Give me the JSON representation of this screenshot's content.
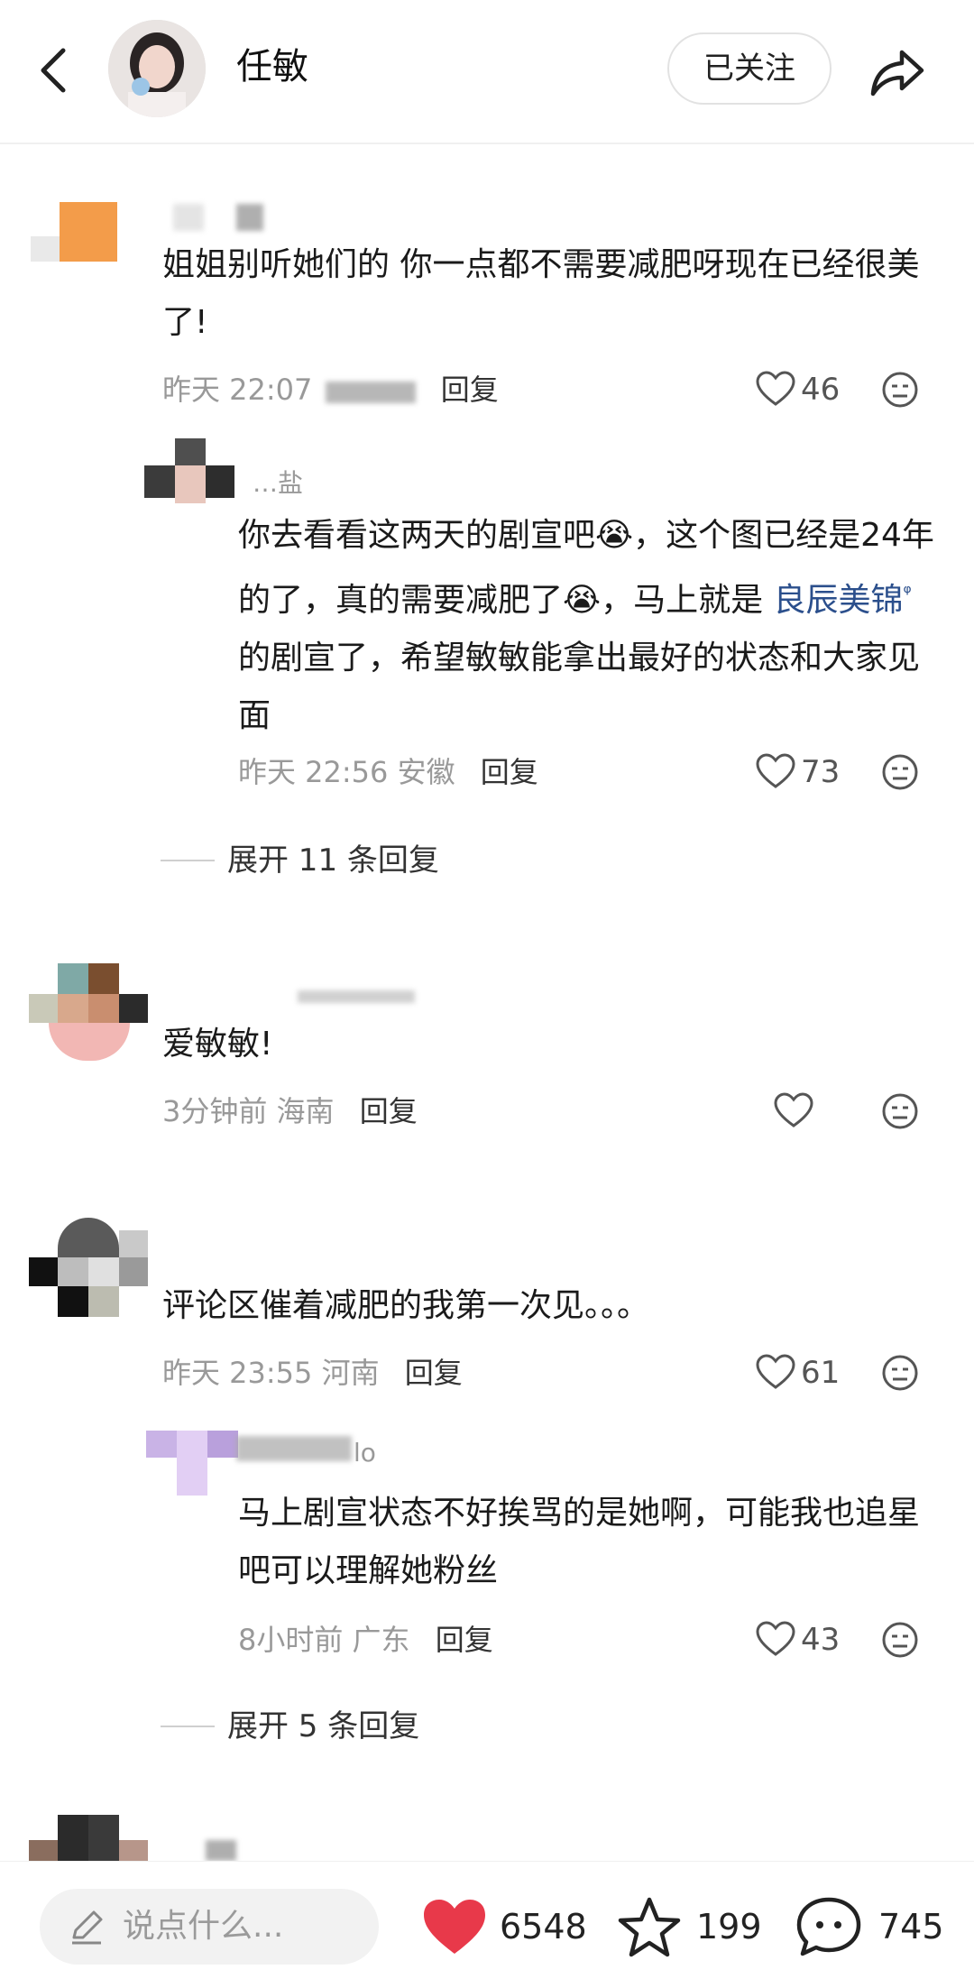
{
  "header": {
    "author_name": "任敏",
    "follow_label": "已关注"
  },
  "comments": [
    {
      "text": "姐姐别听她们的 你一点都不需要减肥呀现在已经很美了!",
      "time": "昨天 22:07",
      "reply_label": "回复",
      "likes": "46"
    },
    {
      "user_suffix": "…盐",
      "text_before": "你去看看这两天的剧宣吧😭，这个图已经是24年的了，真的需要减肥了😭，马上就是",
      "topic": "良辰美锦",
      "text_after": "的剧宣了，希望敏敏能拿出最好的状态和大家见面",
      "time": "昨天 22:56 安徽",
      "reply_label": "回复",
      "likes": "73"
    },
    {
      "expand_label": "展开 11 条回复"
    },
    {
      "text": "爱敏敏!",
      "time": "3分钟前 海南",
      "reply_label": "回复"
    },
    {
      "text": "评论区催着减肥的我第一次见。。。",
      "time": "昨天 23:55 河南",
      "reply_label": "回复",
      "likes": "61"
    },
    {
      "user_suffix": "lo",
      "text": "马上剧宣状态不好挨骂的是她啊，可能我也追星吧可以理解她粉丝",
      "time": "8小时前 广东",
      "reply_label": "回复",
      "likes": "43"
    },
    {
      "expand_label": "展开 5 条回复"
    }
  ],
  "bottom_bar": {
    "input_placeholder": "说点什么...",
    "likes": "6548",
    "favorites": "199",
    "comments": "745"
  },
  "colors": {
    "like_heart": "#e8394a",
    "link": "#2b4f8c",
    "muted_text": "#999999"
  },
  "icons": [
    "back-arrow-icon",
    "share-icon",
    "heart-icon",
    "emoji-icon",
    "pencil-icon",
    "star-icon",
    "comment-bubble-icon"
  ]
}
